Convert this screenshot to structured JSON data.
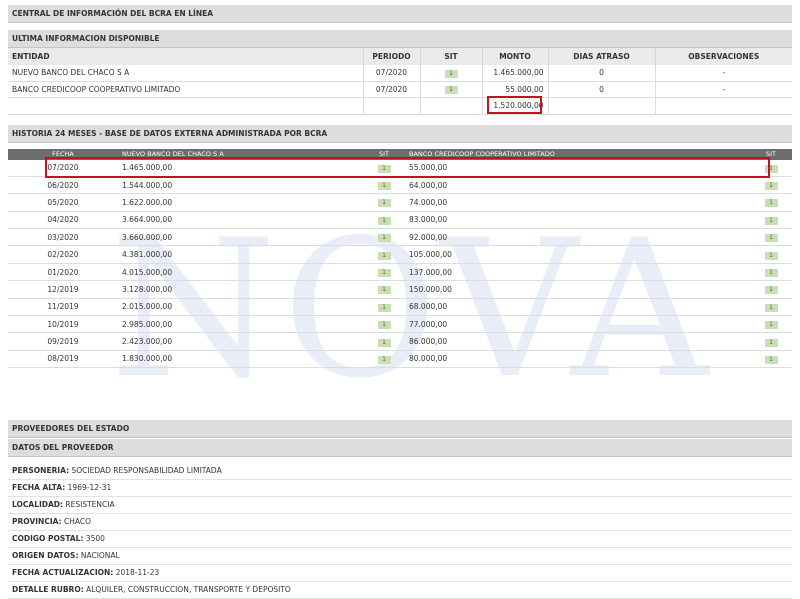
{
  "watermark": "NOVA",
  "title": "CENTRAL DE INFORMACIÓN DEL BCRA EN LÍNEA",
  "ultima": {
    "section_title": "ULTIMA INFORMACION DISPONIBLE",
    "headers": [
      "ENTIDAD",
      "PERIODO",
      "SIT",
      "MONTO",
      "DIAS ATRASO",
      "OBSERVACIONES"
    ],
    "rows": [
      {
        "entidad": "NUEVO BANCO DEL CHACO S A",
        "periodo": "07/2020",
        "sit": "1",
        "monto": "1.465.000,00",
        "dias": "0",
        "obs": "-"
      },
      {
        "entidad": "BANCO CREDICOOP COOPERATIVO LIMITADO",
        "periodo": "07/2020",
        "sit": "1",
        "monto": "55.000,00",
        "dias": "0",
        "obs": "-"
      }
    ],
    "total": "1.520.000,00"
  },
  "historia": {
    "section_title": "HISTORIA 24 MESES - BASE DE DATOS EXTERNA ADMINISTRADA POR BCRA",
    "headers": [
      "FECHA",
      "NUEVO BANCO DEL CHACO S A",
      "SIT",
      "BANCO CREDICOOP COOPERATIVO LIMITADO",
      "SIT"
    ],
    "rows": [
      {
        "fecha": "07/2020",
        "m1": "1.465.000,00",
        "s1": "1",
        "m2": "55.000,00",
        "s2": "1"
      },
      {
        "fecha": "06/2020",
        "m1": "1.544.000,00",
        "s1": "1",
        "m2": "64.000,00",
        "s2": "1"
      },
      {
        "fecha": "05/2020",
        "m1": "1.622.000,00",
        "s1": "1",
        "m2": "74.000,00",
        "s2": "1"
      },
      {
        "fecha": "04/2020",
        "m1": "3.664.000,00",
        "s1": "1",
        "m2": "83.000,00",
        "s2": "1"
      },
      {
        "fecha": "03/2020",
        "m1": "3.660.000,00",
        "s1": "1",
        "m2": "92.000,00",
        "s2": "1"
      },
      {
        "fecha": "02/2020",
        "m1": "4.381.000,00",
        "s1": "1",
        "m2": "105.000,00",
        "s2": "1"
      },
      {
        "fecha": "01/2020",
        "m1": "4.015.000,00",
        "s1": "1",
        "m2": "137.000,00",
        "s2": "1"
      },
      {
        "fecha": "12/2019",
        "m1": "3.128.000,00",
        "s1": "1",
        "m2": "150.000,00",
        "s2": "1"
      },
      {
        "fecha": "11/2019",
        "m1": "2.015.000,00",
        "s1": "1",
        "m2": "68.000,00",
        "s2": "1"
      },
      {
        "fecha": "10/2019",
        "m1": "2.985.000,00",
        "s1": "1",
        "m2": "77.000,00",
        "s2": "1"
      },
      {
        "fecha": "09/2019",
        "m1": "2.423.000,00",
        "s1": "1",
        "m2": "86.000,00",
        "s2": "1"
      },
      {
        "fecha": "08/2019",
        "m1": "1.830.000,00",
        "s1": "1",
        "m2": "80.000,00",
        "s2": "1"
      }
    ]
  },
  "proveedores": {
    "section_title": "PROVEEDORES DEL ESTADO",
    "subsection_title": "DATOS DEL PROVEEDOR",
    "fields": [
      {
        "label": "PERSONERIA:",
        "value": "SOCIEDAD RESPONSABILIDAD LIMITADA"
      },
      {
        "label": "FECHA ALTA:",
        "value": "1969-12-31"
      },
      {
        "label": "LOCALIDAD:",
        "value": "RESISTENCIA"
      },
      {
        "label": "PROVINCIA:",
        "value": "CHACO"
      },
      {
        "label": "CODIGO POSTAL:",
        "value": "3500"
      },
      {
        "label": "ORIGEN DATOS:",
        "value": "NACIONAL"
      },
      {
        "label": "FECHA ACTUALIZACION:",
        "value": "2018-11-23"
      },
      {
        "label": "DETALLE RUBRO:",
        "value": "ALQUILER, CONSTRUCCION, TRANSPORTE Y DEPOSITO"
      }
    ]
  },
  "colors": {
    "highlight": "#c0141e",
    "sit_badge": "#c9dfb2",
    "header_bar": "#dddddd"
  }
}
